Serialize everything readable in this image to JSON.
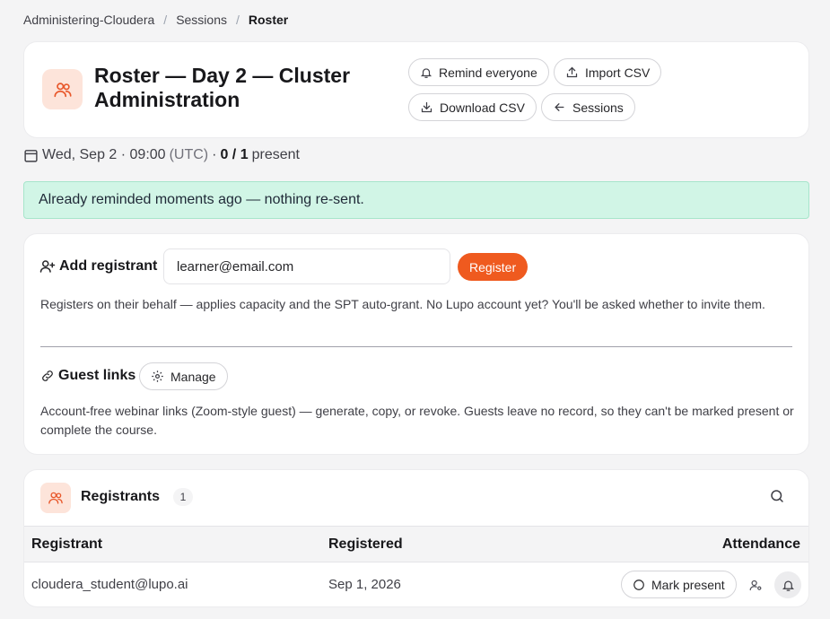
{
  "breadcrumb": {
    "items": [
      "Administering-Cloudera",
      "Sessions",
      "Roster"
    ],
    "separator": "/"
  },
  "header": {
    "title": "Roster — Day 2 — Cluster Administration",
    "actions": {
      "remind": "Remind everyone",
      "import": "Import CSV",
      "download": "Download CSV",
      "sessions": "Sessions"
    }
  },
  "meta": {
    "date": "Wed, Sep 2 · 09:00",
    "timezone": "(UTC)",
    "dot": "·",
    "present_count": "0 / 1",
    "present_label": "present"
  },
  "alert": {
    "text": "Already reminded moments ago — nothing re-sent."
  },
  "add_registrant": {
    "label": "Add registrant",
    "input_value": "learner@email.com",
    "button": "Register",
    "help": "Registers on their behalf — applies capacity and the SPT auto-grant. No Lupo account yet? You'll be asked whether to invite them."
  },
  "guest_links": {
    "label": "Guest links",
    "button": "Manage",
    "help": "Account-free webinar links (Zoom-style guest) — generate, copy, or revoke. Guests leave no record, so they can't be marked present or complete the course."
  },
  "registrants": {
    "title": "Registrants",
    "count": "1",
    "columns": {
      "registrant": "Registrant",
      "registered": "Registered",
      "attendance": "Attendance"
    },
    "rows": [
      {
        "email": "cloudera_student@lupo.ai",
        "registered": "Sep 1, 2026",
        "action": "Mark present"
      }
    ]
  },
  "colors": {
    "accent": "#ef5a1f",
    "icon_bg": "#fde4da",
    "success_bg": "#d1f5e6"
  },
  "icons": [
    "users-icon",
    "bell-icon",
    "upload-icon",
    "download-icon",
    "arrow-left-icon",
    "calendar-icon",
    "user-plus-icon",
    "link-icon",
    "gear-icon",
    "search-icon",
    "circle-icon",
    "user-settings-icon"
  ]
}
